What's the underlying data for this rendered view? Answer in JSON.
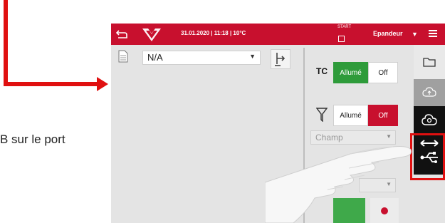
{
  "caption": "B sur le port",
  "topbar": {
    "datetime": "31.01.2020 | 11:18 | 10°C",
    "start_label": "START",
    "mode": "Epandeur"
  },
  "left_panel": {
    "job_select_value": "N/A"
  },
  "right_panel": {
    "tc_label": "TC",
    "tc_on": "Allumé",
    "tc_off": "Off",
    "filter_on": "Allumé",
    "filter_off": "Off",
    "field_placeholder": "Champ"
  },
  "colors": {
    "brand_red": "#c8102e",
    "active_green": "#2e9b3a",
    "annotation_red": "#e01010"
  },
  "icons": [
    "back-icon",
    "massey-ferguson-logo",
    "save-icon",
    "menu-icon",
    "file-icon",
    "mapping-icon",
    "folder-icon",
    "cloud-sync-icon",
    "cloud-gear-icon",
    "usb-icon",
    "funnel-icon"
  ]
}
